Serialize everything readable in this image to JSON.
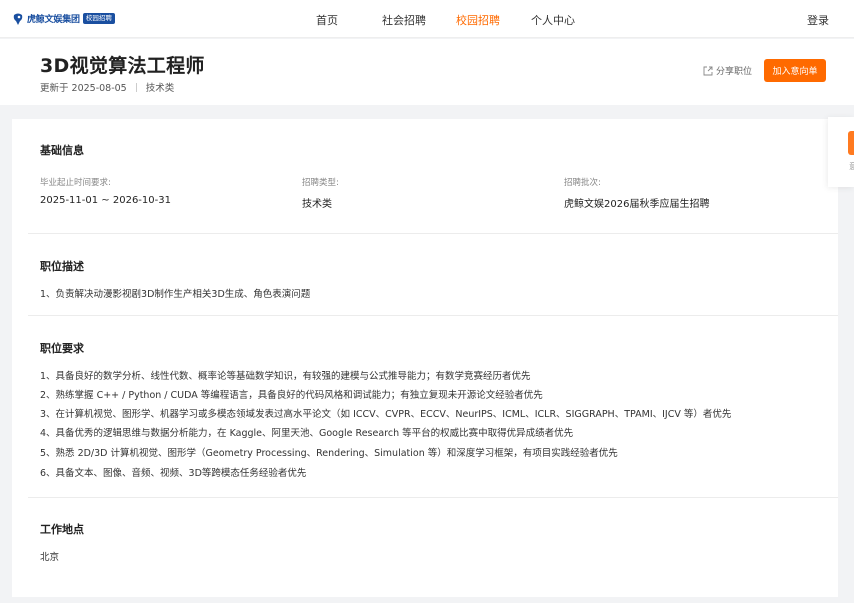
{
  "header": {
    "logo_text": "虎鲸文娱集团",
    "logo_badge": "校园招聘",
    "nav": [
      {
        "label": "首页",
        "active": false
      },
      {
        "label": "社会招聘",
        "active": false
      },
      {
        "label": "校园招聘",
        "active": true
      },
      {
        "label": "个人中心",
        "active": false
      }
    ],
    "login_label": "登录"
  },
  "job": {
    "title": "3D视觉算法工程师",
    "updated": "更新于 2025-08-05",
    "category": "技术类",
    "share_label": "分享职位",
    "apply_label": "加入意向单"
  },
  "basic_info": {
    "section_title": "基础信息",
    "fields": [
      {
        "label": "毕业起止时间要求:",
        "value": "2025-11-01 ~ 2026-10-31"
      },
      {
        "label": "招聘类型:",
        "value": "技术类"
      },
      {
        "label": "招聘批次:",
        "value": "虎鲸文娱2026届秋季应届生招聘"
      }
    ]
  },
  "description": {
    "section_title": "职位描述",
    "lines": [
      "1、负责解决动漫影视剧3D制作生产相关3D生成、角色表演问题"
    ]
  },
  "requirements": {
    "section_title": "职位要求",
    "lines": [
      "1、具备良好的数学分析、线性代数、概率论等基础数学知识，有较强的建模与公式推导能力；有数学竞赛经历者优先",
      "2、熟练掌握 C++ / Python / CUDA 等编程语言，具备良好的代码风格和调试能力；有独立复现未开源论文经验者优先",
      "3、在计算机视觉、图形学、机器学习或多模态领域发表过高水平论文（如 ICCV、CVPR、ECCV、NeurIPS、ICML、ICLR、SIGGRAPH、TPAMI、IJCV 等）者优先",
      "4、具备优秀的逻辑思维与数据分析能力，在 Kaggle、阿里天池、Google Research 等平台的权威比赛中取得优异成绩者优先",
      "5、熟悉 2D/3D 计算机视觉、图形学（Geometry Processing、Rendering、Simulation 等）和深度学习框架，有项目实践经验者优先",
      "6、具备文本、图像、音频、视频、3D等跨模态任务经验者优先"
    ]
  },
  "location": {
    "section_title": "工作地点",
    "value": "北京"
  },
  "float_tab": {
    "char": "意"
  },
  "colors": {
    "accent": "#ff6a00",
    "brand": "#1a4fa0"
  }
}
